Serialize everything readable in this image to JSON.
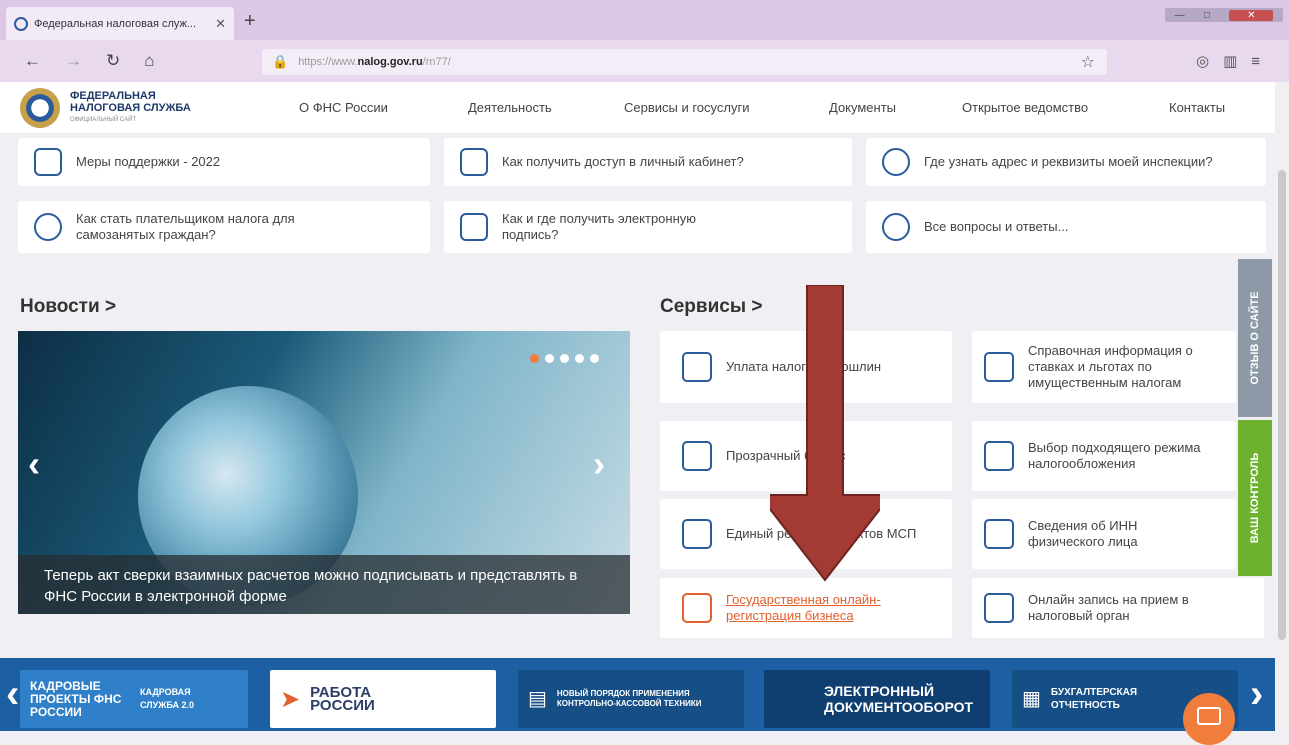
{
  "browser": {
    "tab_title": "Федеральная налоговая служ...",
    "tab_close": "✕",
    "new_tab": "+",
    "url_scheme": "https://www.",
    "url_host": "nalog.gov.ru",
    "url_path": "/rn77/"
  },
  "header": {
    "logo_line1": "ФЕДЕРАЛЬНАЯ",
    "logo_line2": "НАЛОГОВАЯ СЛУЖБА",
    "logo_line3": "ОФИЦИАЛЬНЫЙ САЙТ",
    "menu": [
      "О ФНС России",
      "Деятельность",
      "Сервисы и госуслуги",
      "Документы",
      "Открытое ведомство",
      "Контакты"
    ]
  },
  "faq": [
    "Меры поддержки - 2022",
    "Как получить доступ в личный кабинет?",
    "Где узнать адрес и реквизиты моей инспекции?",
    "Как стать плательщиком налога для самозанятых граждан?",
    "Как и где получить электронную подпись?",
    "Все вопросы и ответы..."
  ],
  "news": {
    "heading": "Новости >",
    "caption": "Теперь акт сверки взаимных расчетов можно подписывать и представлять в ФНС России в электронной форме",
    "prev": "‹",
    "next": "›"
  },
  "services": {
    "heading": "Сервисы >",
    "items": [
      "Уплата налогов и пошлин",
      "Справочная информация о ставках и льготах по имущественным налогам",
      "Прозрачный бизнес",
      "Выбор подходящего режима налогообложения",
      "Единый реестр субъектов МСП",
      "Сведения об ИНН физического лица",
      "Государственная онлайн-регистрация бизнеса",
      "Онлайн запись на прием в налоговый орган"
    ]
  },
  "side": {
    "feedback": "ОТЗЫВ О САЙТЕ",
    "control": "ВАШ КОНТРОЛЬ"
  },
  "banners": [
    {
      "label": "КАДРОВЫЕ ПРОЕКТЫ ФНС РОССИИ",
      "sub": "КАДРОВАЯ СЛУЖБА 2.0"
    },
    {
      "label": "РАБОТА РОССИИ"
    },
    {
      "label": "НОВЫЙ ПОРЯДОК ПРИМЕНЕНИЯ КОНТРОЛЬНО-КАССОВОЙ ТЕХНИКИ"
    },
    {
      "label": "ЭЛЕКТРОННЫЙ ДОКУМЕНТООБОРОТ"
    },
    {
      "label": "БУХГАЛТЕРСКАЯ ОТЧЕТНОСТЬ"
    }
  ],
  "colors": {
    "accent": "#2c5b9c",
    "link": "#e0602f",
    "arrow": "#a33a34",
    "control": "#6db22f"
  }
}
